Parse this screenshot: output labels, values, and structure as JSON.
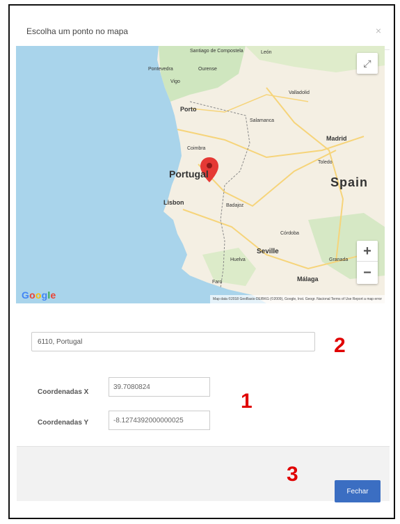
{
  "modal": {
    "title": "Escolha um ponto no mapa",
    "close_glyph": "×"
  },
  "map": {
    "labels": {
      "santiago": "Santiago de Compostela",
      "leon": "León",
      "pontevedra": "Pontevedra",
      "ourense": "Ourense",
      "vigo": "Vigo",
      "valladolid": "Valladolid",
      "porto": "Porto",
      "salamanca": "Salamanca",
      "madrid": "Madrid",
      "coimbra": "Coimbra",
      "toledo": "Toledo",
      "portugal": "Portugal",
      "spain": "Spain",
      "lisbon": "Lisbon",
      "badajoz": "Badajoz",
      "cordoba": "Córdoba",
      "seville": "Seville",
      "huelva": "Huelva",
      "granada": "Granada",
      "malaga": "Málaga",
      "faro": "Faro"
    },
    "google_logo": "Google",
    "attribution": "Map data ©2018 GeoBasis-DE/BKG (©2009), Google, Inst. Geogr. Nacional  Terms of Use  Report a map error",
    "fullscreen_icon": "fullscreen-icon",
    "zoom_in_label": "+",
    "zoom_out_label": "−",
    "colors": {
      "water": "#a9d4eb",
      "land": "#f4efe3",
      "green": "#cfe6bf",
      "road": "#f6d47a",
      "marker": "#e53935"
    }
  },
  "address": {
    "value": "6110, Portugal"
  },
  "coordinates": {
    "x_label": "Coordenadas X",
    "x_value": "39.7080824",
    "y_label": "Coordenadas Y",
    "y_value": "-8.1274392000000025"
  },
  "callouts": {
    "one": "1",
    "two": "2",
    "three": "3"
  },
  "footer": {
    "close_button_label": "Fechar"
  }
}
